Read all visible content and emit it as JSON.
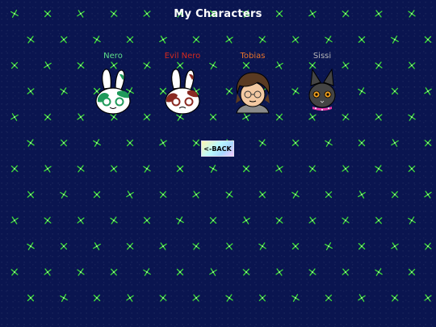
{
  "page": {
    "title": "My Characters"
  },
  "characters": [
    {
      "name": "Nero",
      "color": "#5fe08a"
    },
    {
      "name": "Evil Nero",
      "color": "#d62a1e"
    },
    {
      "name": "Tobias",
      "color": "#e8742a"
    },
    {
      "name": "Sissi",
      "color": "#b8b8b8"
    }
  ],
  "back_button": {
    "label": "<-BACK"
  },
  "background": {
    "base_color": "#0a1550",
    "star_color": "#3ee03a"
  }
}
